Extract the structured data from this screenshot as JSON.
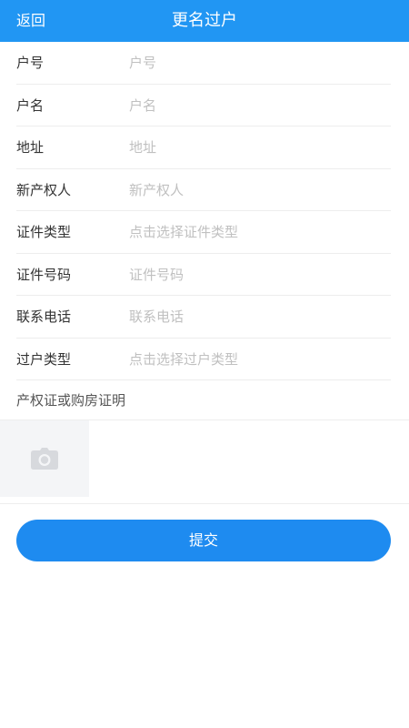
{
  "header": {
    "back_label": "返回",
    "title": "更名过户"
  },
  "form": {
    "fields": [
      {
        "label": "户号",
        "placeholder": "户号",
        "type": "input"
      },
      {
        "label": "户名",
        "placeholder": "户名",
        "type": "input"
      },
      {
        "label": "地址",
        "placeholder": "地址",
        "type": "input"
      },
      {
        "label": "新产权人",
        "placeholder": "新产权人",
        "type": "input"
      },
      {
        "label": "证件类型",
        "placeholder": "点击选择证件类型",
        "type": "select"
      },
      {
        "label": "证件号码",
        "placeholder": "证件号码",
        "type": "input"
      },
      {
        "label": "联系电话",
        "placeholder": "联系电话",
        "type": "input"
      },
      {
        "label": "过户类型",
        "placeholder": "点击选择过户类型",
        "type": "select"
      }
    ],
    "upload_label": "产权证或购房证明",
    "upload_icon": "camera-icon"
  },
  "submit_label": "提交",
  "colors": {
    "header_bg": "#2196f3",
    "button_bg": "#1e8bf0",
    "placeholder": "#c0c0c0",
    "upload_tile_bg": "#f4f5f7"
  }
}
